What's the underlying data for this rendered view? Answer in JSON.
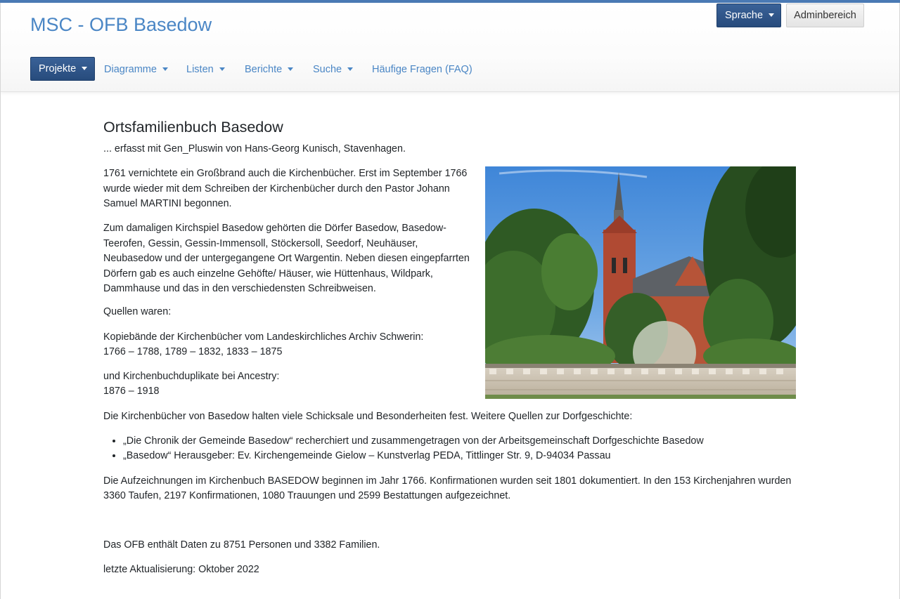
{
  "header": {
    "site_title": "MSC - OFB Basedow",
    "language_button": "Sprache",
    "admin_button": "Adminbereich"
  },
  "nav": {
    "items": [
      {
        "label": "Projekte"
      },
      {
        "label": "Diagramme"
      },
      {
        "label": "Listen"
      },
      {
        "label": "Berichte"
      },
      {
        "label": "Suche"
      },
      {
        "label": "Häufige Fragen (FAQ)"
      }
    ]
  },
  "main": {
    "title": "Ortsfamilienbuch Basedow",
    "subtitle": "... erfasst mit Gen_Pluswin von Hans-Georg Kunisch, Stavenhagen.",
    "para1_lines": [
      "1761 vernichtete ein Großbrand auch die Kirchenbücher. Erst im September 1766",
      "wurde wieder mit dem Schreiben der Kirchenbücher durch den Pastor Johann",
      "Samuel MARTINI begonnen."
    ],
    "para2_lines": [
      "Zum damaligen Kirchspiel Basedow gehörten die Dörfer Basedow, Basedow-",
      "Teerofen, Gessin, Gessin-Immensoll, Stöckersoll, Seedorf, Neuhäuser,",
      "Neubasedow und der untergegangene Ort Wargentin. Neben diesen eingepfarrten",
      "Dörfern gab es auch einzelne Gehöfte/ Häuser, wie Hüttenhaus, Wildpark,",
      "Dammhause und das in den verschiedensten Schreibweisen."
    ],
    "sources_heading": "Quellen waren:",
    "kopie_line1": "Kopiebände der Kirchenbücher vom Landeskirchliches Archiv Schwerin:",
    "kopie_line2": "1766 – 1788, 1789 – 1832, 1833 – 1875",
    "dup_line1": "und Kirchenbuchduplikate bei Ancestry:",
    "dup_line2": "1876 – 1918",
    "more_sources": "Die Kirchenbücher von Basedow halten viele Schicksale und Besonderheiten fest. Weitere Quellen zur Dorfgeschichte:",
    "source_items": [
      "„Die Chronik der Gemeinde Basedow“ recherchiert und zusammengetragen von der Arbeitsgemeinschaft Dorfgeschichte Basedow",
      "„Basedow“ Herausgeber: Ev. Kirchengemeinde Gielow – Kunstverlag PEDA, Tittlinger Str. 9, D-94034 Passau"
    ],
    "records_line1": "Die Aufzeichnungen im Kirchenbuch BASEDOW beginnen im Jahr 1766. Konfirmationen wurden seit 1801 dokumentiert. In den 153 Kirchenjahren wurden",
    "records_line2": "3360 Taufen, 2197 Konfirmationen, 1080 Trauungen und 2599 Bestattungen aufgezeichnet.",
    "stats": "Das OFB enthält Daten zu 8751 Personen und 3382 Familien.",
    "last_update": "letzte Aktualisierung: Oktober 2022"
  },
  "colors": {
    "accent": "#4a86c5",
    "button_dark": "#274b7c"
  }
}
